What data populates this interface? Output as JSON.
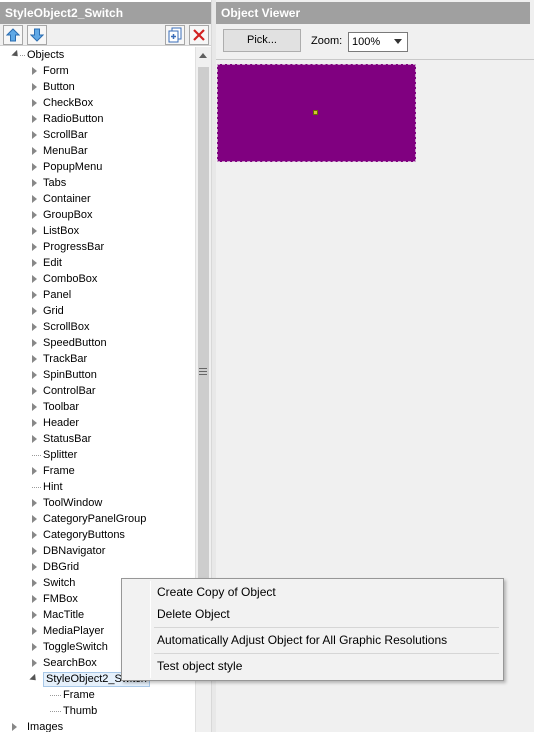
{
  "left_panel": {
    "title": "StyleObject2_Switch",
    "toolbar": {
      "move_up_icon": "arrow-up-icon",
      "move_down_icon": "arrow-down-icon",
      "copy_icon": "copy-page-icon",
      "delete_icon": "red-x-icon"
    },
    "tree": {
      "root_label": "Objects",
      "items": [
        "Form",
        "Button",
        "CheckBox",
        "RadioButton",
        "ScrollBar",
        "MenuBar",
        "PopupMenu",
        "Tabs",
        "Container",
        "GroupBox",
        "ListBox",
        "ProgressBar",
        "Edit",
        "ComboBox",
        "Panel",
        "Grid",
        "ScrollBox",
        "SpeedButton",
        "TrackBar",
        "SpinButton",
        "ControlBar",
        "Toolbar",
        "Header",
        "StatusBar",
        "Splitter",
        "Frame",
        "Hint",
        "ToolWindow",
        "CategoryPanelGroup",
        "CategoryButtons",
        "DBNavigator",
        "DBGrid",
        "Switch",
        "FMBox",
        "MacTitle",
        "MediaPlayer",
        "ToggleSwitch",
        "SearchBox",
        "StyleObject2_Switch"
      ],
      "children_of_selected": [
        "Frame",
        "Thumb"
      ],
      "images_label": "Images"
    }
  },
  "right_panel": {
    "title": "Object Viewer",
    "pick_label": "Pick...",
    "zoom_label": "Zoom:",
    "zoom_value": "100%",
    "preview_color": "#800080"
  },
  "context_menu": {
    "items": [
      "Create Copy of Object",
      "Delete Object",
      "Automatically Adjust Object for All Graphic Resolutions",
      "Test object style"
    ]
  }
}
